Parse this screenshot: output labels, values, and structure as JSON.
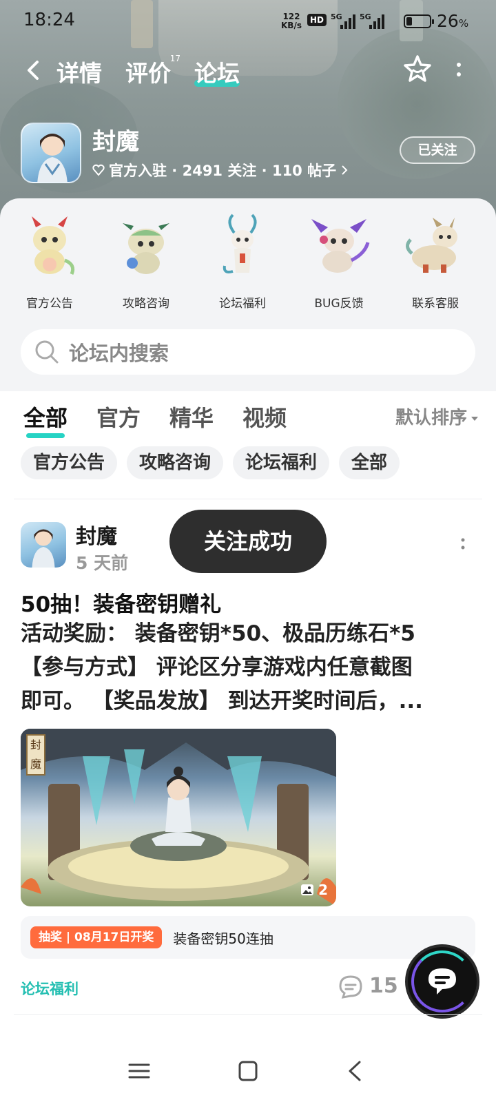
{
  "status_bar": {
    "time": "18:24",
    "net_speed_value": "122",
    "net_speed_unit": "KB/s",
    "hd": "HD",
    "sim1": "5G",
    "sim2": "5G",
    "battery": "26",
    "battery_unit": "%",
    "battery_level": 0.26
  },
  "nav": {
    "tabs": [
      {
        "label": "详情",
        "badge": ""
      },
      {
        "label": "评价",
        "badge": "17"
      },
      {
        "label": "论坛",
        "badge": ""
      }
    ],
    "active_tab": "论坛"
  },
  "app": {
    "name": "封魔",
    "meta": "官方入驻 · 2491 关注 · 110 帖子",
    "follow_label": "已关注"
  },
  "categories": [
    {
      "label": "官方公告",
      "icon": "red-horned-dragon-mascot"
    },
    {
      "label": "攻略咨询",
      "icon": "green-dragon-mascot"
    },
    {
      "label": "论坛福利",
      "icon": "white-antlered-mascot"
    },
    {
      "label": "BUG反馈",
      "icon": "purple-winged-mascot"
    },
    {
      "label": "联系客服",
      "icon": "beige-dragon-mascot"
    }
  ],
  "search": {
    "placeholder": "论坛内搜索"
  },
  "filter_tabs": [
    "全部",
    "官方",
    "精华",
    "视频"
  ],
  "active_filter": "全部",
  "sort_label": "默认排序",
  "chips": [
    "官方公告",
    "攻略咨询",
    "论坛福利",
    "全部"
  ],
  "post": {
    "author": "封魔",
    "time": "5 天前",
    "title": "50抽！装备密钥赠礼",
    "body_lines": [
      "活动奖励： 装备密钥*50、极品历练石*5",
      "【参与方式】 评论区分享游戏内任意截图",
      "即可。 【奖品发放】 到达开奖时间后，..."
    ],
    "image_count": "2",
    "image_seal": "封魔",
    "lottery_tag": "抽奖 | 08月17日开奖",
    "lottery_text": "装备密钥50连抽",
    "topic": "论坛福利",
    "comments": "15"
  },
  "toast": "关注成功",
  "colors": {
    "accent": "#26d3c4",
    "lottery": "#ff6b3d",
    "topic": "#25bfb2"
  }
}
